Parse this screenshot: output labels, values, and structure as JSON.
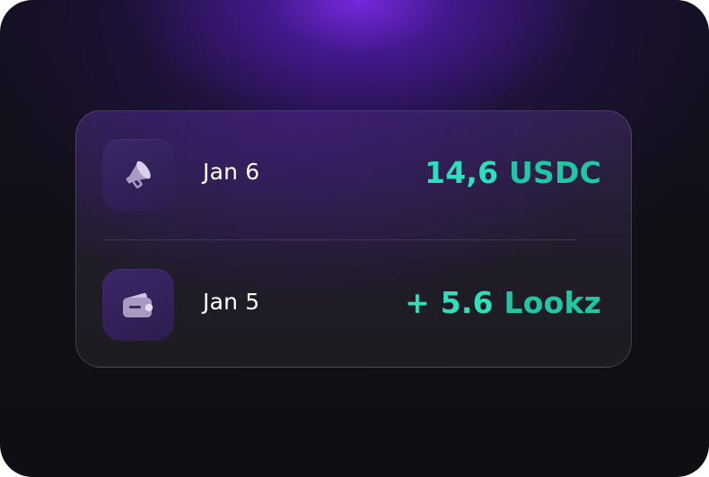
{
  "transactions": [
    {
      "icon": "megaphone-icon",
      "date": "Jan 6",
      "amount_number": "14,6",
      "amount_unit": "USDC"
    },
    {
      "icon": "wallet-icon",
      "date": "Jan 5",
      "amount_number": "+ 5.6",
      "amount_unit": "Lookz"
    }
  ],
  "colors": {
    "accent": "#2be0bb",
    "icon_tile": "#3c2668",
    "glow": "#7c28e6"
  }
}
